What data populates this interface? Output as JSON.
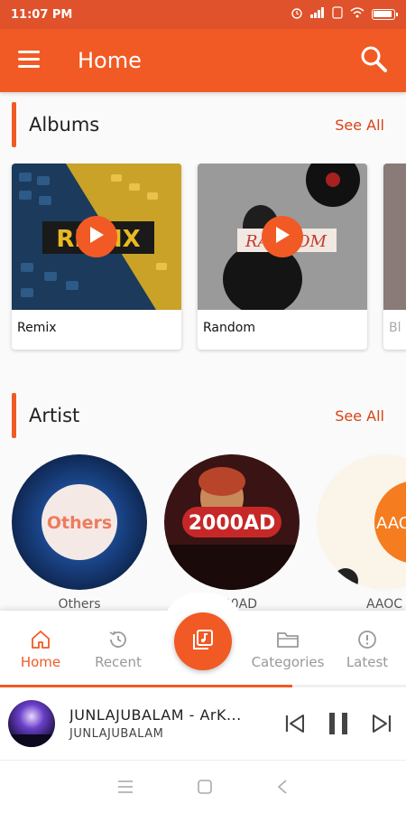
{
  "status_bar": {
    "time": "11:07 PM",
    "battery_level": 0.95
  },
  "app_bar": {
    "title": "Home"
  },
  "albums": {
    "title": "Albums",
    "see_all": "See All",
    "items": [
      {
        "name": "Remix",
        "art_text": "REMIX"
      },
      {
        "name": "Random",
        "art_text": "RANDOM"
      },
      {
        "name": "Bl"
      }
    ]
  },
  "artists": {
    "title": "Artist",
    "see_all": "See All",
    "items": [
      {
        "name": "Others",
        "art_text": "Others"
      },
      {
        "name": "2000AD",
        "art_text": "2000AD"
      },
      {
        "name": "AAOC",
        "art_text": "AAOC"
      }
    ]
  },
  "bottom_nav": {
    "items": [
      {
        "label": "Home",
        "icon": "home-icon"
      },
      {
        "label": "Recent",
        "icon": "history-icon"
      },
      {
        "label": "Categories",
        "icon": "folder-icon"
      },
      {
        "label": "Latest",
        "icon": "alert-circle-icon"
      }
    ],
    "fab_icon": "music-library-icon"
  },
  "now_playing": {
    "title": "JUNLAJUBALAM - ArK...",
    "artist": "JUNLAJUBALAM",
    "progress": 0.72
  },
  "colors": {
    "accent": "#f15a24",
    "status_bar": "#e0522b",
    "link": "#d84315"
  }
}
